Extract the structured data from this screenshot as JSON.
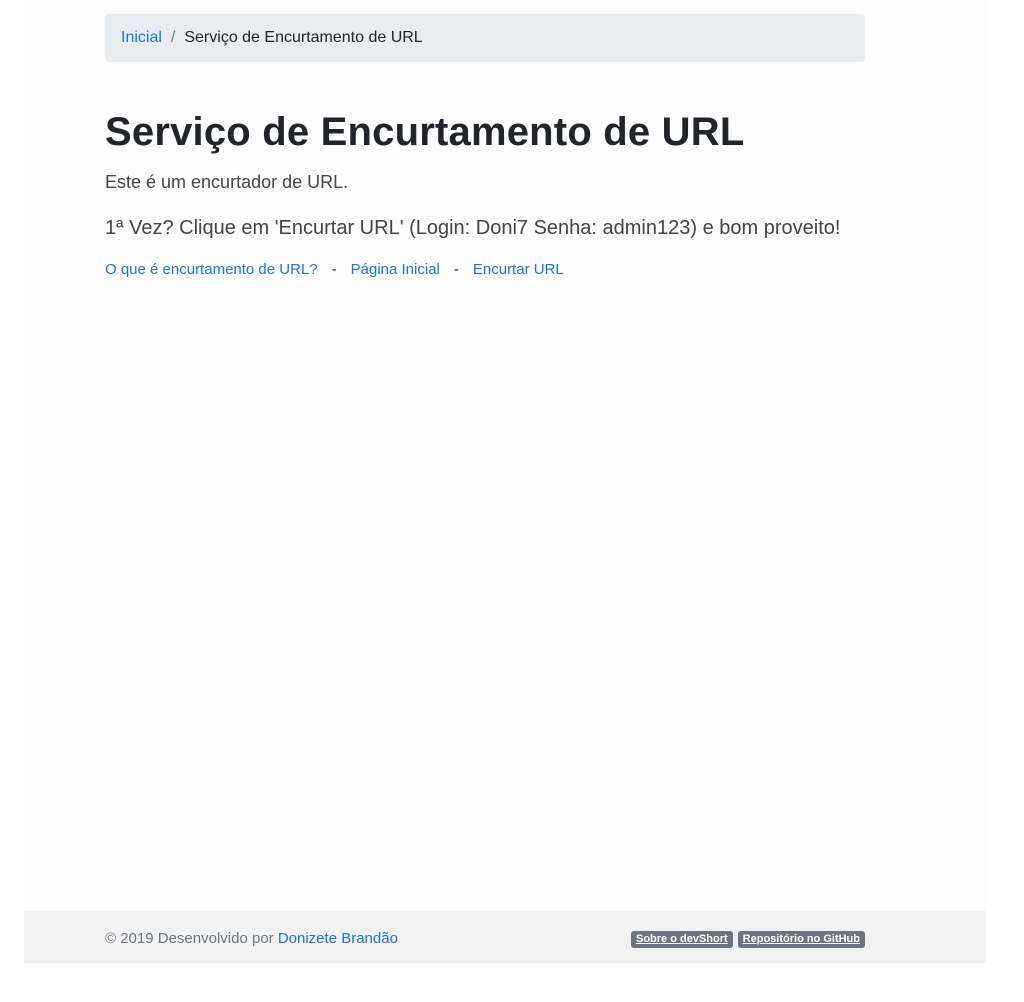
{
  "breadcrumb": {
    "home_label": "Inicial",
    "separator": "/",
    "current_label": "Serviço de Encurtamento de URL"
  },
  "header": {
    "title": "Serviço de Encurtamento de URL",
    "lead": "Este é um encurtador de URL.",
    "instructions": "1ª Vez? Clique em 'Encurtar URL' (Login: Doni7 Senha: admin123) e bom proveito!"
  },
  "nav_links": {
    "what_is": "O que é encurtamento de URL?",
    "separator": "-",
    "home": "Página Inicial",
    "shorten": "Encurtar URL"
  },
  "footer": {
    "copyright": "© 2019 Desenvolvido por ",
    "author": "Donizete Brandão",
    "badge_about": "Sobre o devShort",
    "badge_github": "Repositório no GitHub"
  },
  "colors": {
    "link": "#1a73e8",
    "breadcrumb_bg": "#e9ecef",
    "footer_bg": "#f2f2f2",
    "badge_bg": "#6c757d"
  }
}
